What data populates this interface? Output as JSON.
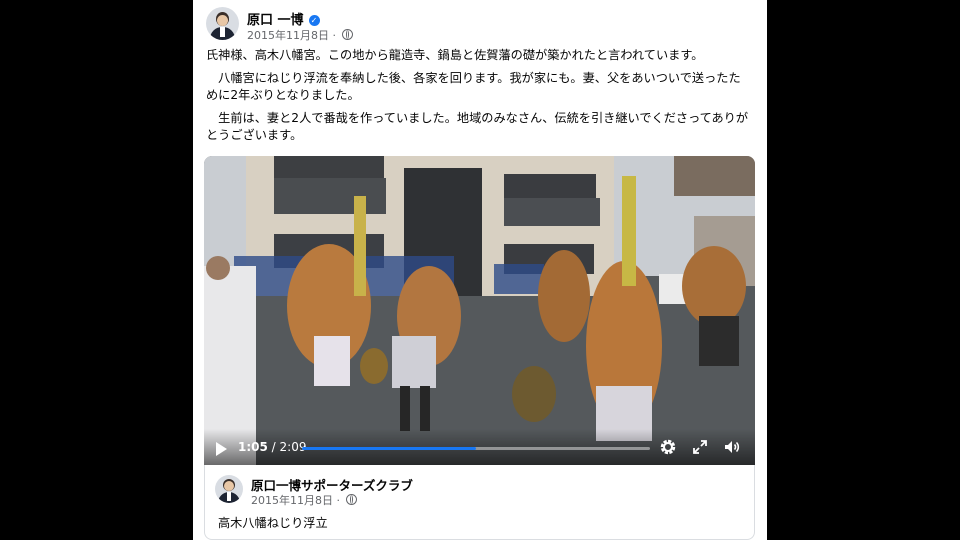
{
  "post": {
    "author": "原口 一博",
    "date": "2015年11月8日",
    "meta_separator": " · ",
    "paragraphs": [
      "氏神様、高木八幡宮。この地から龍造寺、鍋島と佐賀藩の礎が築かれたと言われています。",
      "　八幡宮にねじり浮流を奉納した後、各家を回ります。我が家にも。妻、父をあいついで送ったために2年ぶりとなりました。",
      "　生前は、妻と2人で番哉を作っていました。地域のみなさん、伝統を引き継いでくださってありがとうございます。"
    ]
  },
  "video": {
    "current_time": "1:05",
    "separator": " / ",
    "duration": "2:09",
    "progress": 0.5,
    "accent": "#1877f2",
    "icons": [
      "play-icon",
      "gear-icon",
      "fullscreen-icon",
      "volume-icon"
    ]
  },
  "shared": {
    "page_name": "原口一博サポーターズクラブ",
    "date": "2015年11月8日",
    "meta_separator": " · ",
    "caption": "高木八幡ねじり浮立"
  }
}
